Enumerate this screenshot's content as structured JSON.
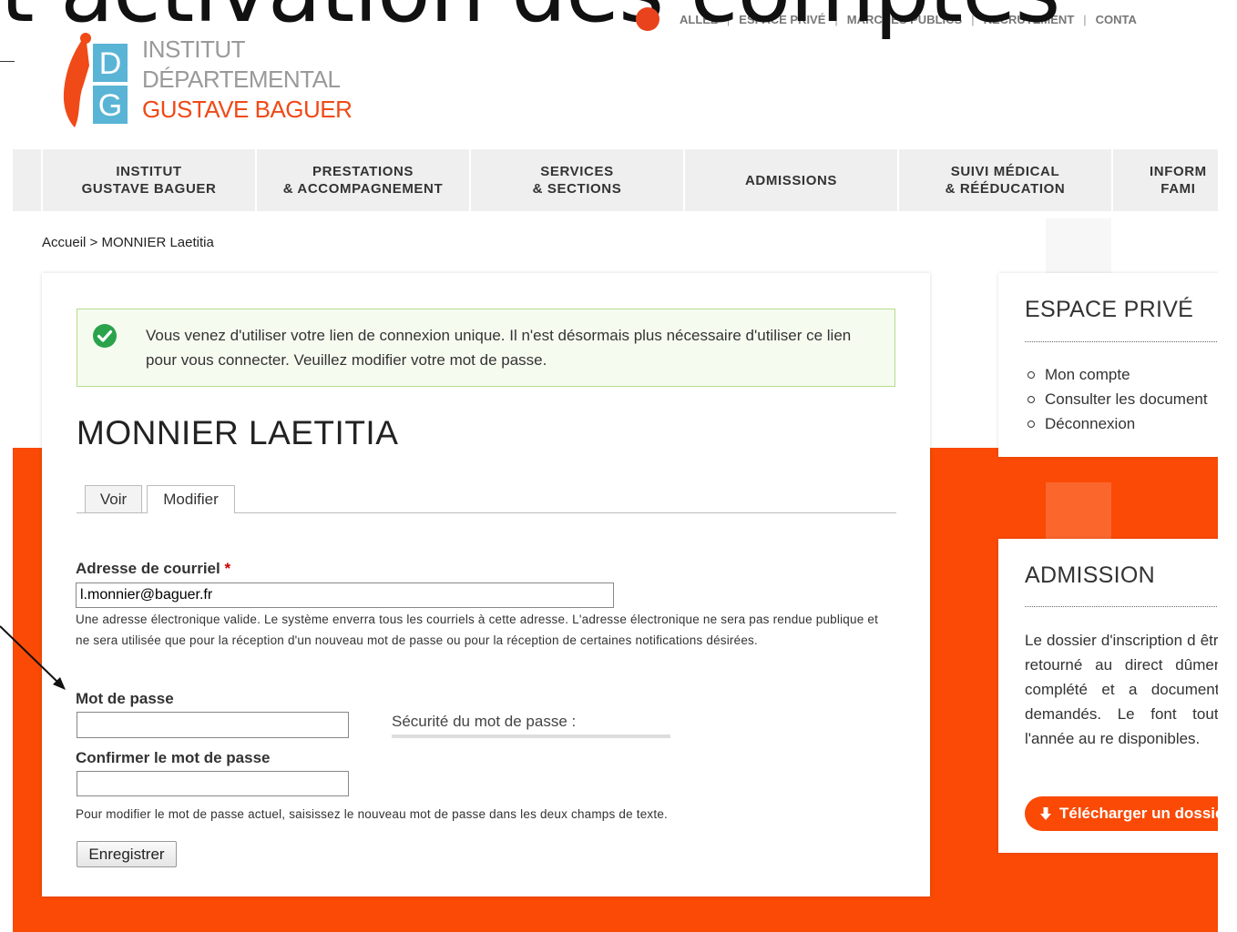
{
  "overlay": {
    "slide_title": "t activation des comptes"
  },
  "top_links": {
    "items": [
      "ALLEZ",
      "ESPACE PRIVÉ",
      "MARCHÉS PUBLICS",
      "RECRUTEMENT",
      "CONTA"
    ]
  },
  "logo": {
    "letters": [
      "D",
      "G"
    ],
    "line1": "INSTITUT",
    "line2": "DÉPARTEMENTAL",
    "line3": "GUSTAVE BAGUER"
  },
  "nav": {
    "items": [
      "INSTITUT\nGUSTAVE BAGUER",
      "PRESTATIONS\n& ACCOMPAGNEMENT",
      "SERVICES\n& SECTIONS",
      "ADMISSIONS",
      "SUIVI MÉDICAL\n& RÉÉDUCATION",
      "INFORM\nFAMI"
    ]
  },
  "breadcrumb": {
    "home": "Accueil",
    "separator": ">",
    "current": "MONNIER Laetitia"
  },
  "message": {
    "text": "Vous venez d'utiliser votre lien de connexion unique. Il n'est désormais plus nécessaire d'utiliser ce lien pour vous connecter. Veuillez modifier votre mot de passe."
  },
  "page": {
    "title": "MONNIER LAETITIA"
  },
  "tabs": {
    "view": "Voir",
    "edit": "Modifier"
  },
  "form": {
    "email_label": "Adresse de courriel",
    "required_mark": "*",
    "email_value": "l.monnier@baguer.fr",
    "email_desc": "Une adresse électronique valide. Le système enverra tous les courriels à cette adresse. L'adresse électronique ne sera pas rendue publique et ne sera utilisée que pour la réception d'un nouveau mot de passe ou pour la réception de certaines notifications désirées.",
    "password_label": "Mot de passe",
    "password_strength_label": "Sécurité du mot de passe :",
    "confirm_label": "Confirmer le mot de passe",
    "password_desc": "Pour modifier le mot de passe actuel, saisissez le nouveau mot de passe dans les deux champs de texte.",
    "save_label": "Enregistrer"
  },
  "sidebar": {
    "private": {
      "title": "ESPACE PRIVÉ",
      "links": [
        "Mon compte",
        "Consulter les document",
        "Déconnexion"
      ]
    },
    "admission": {
      "title": "ADMISSION",
      "text": "Le dossier d'inscription d être retourné au direct dûment complété et a documents demandés. Le font toute l'année au re disponibles.",
      "download_label": "Télécharger un dossie"
    }
  },
  "colors": {
    "brand_orange": "#fa4a06",
    "logo_blue": "#5ab4d6",
    "success_green": "#2aa34a"
  }
}
